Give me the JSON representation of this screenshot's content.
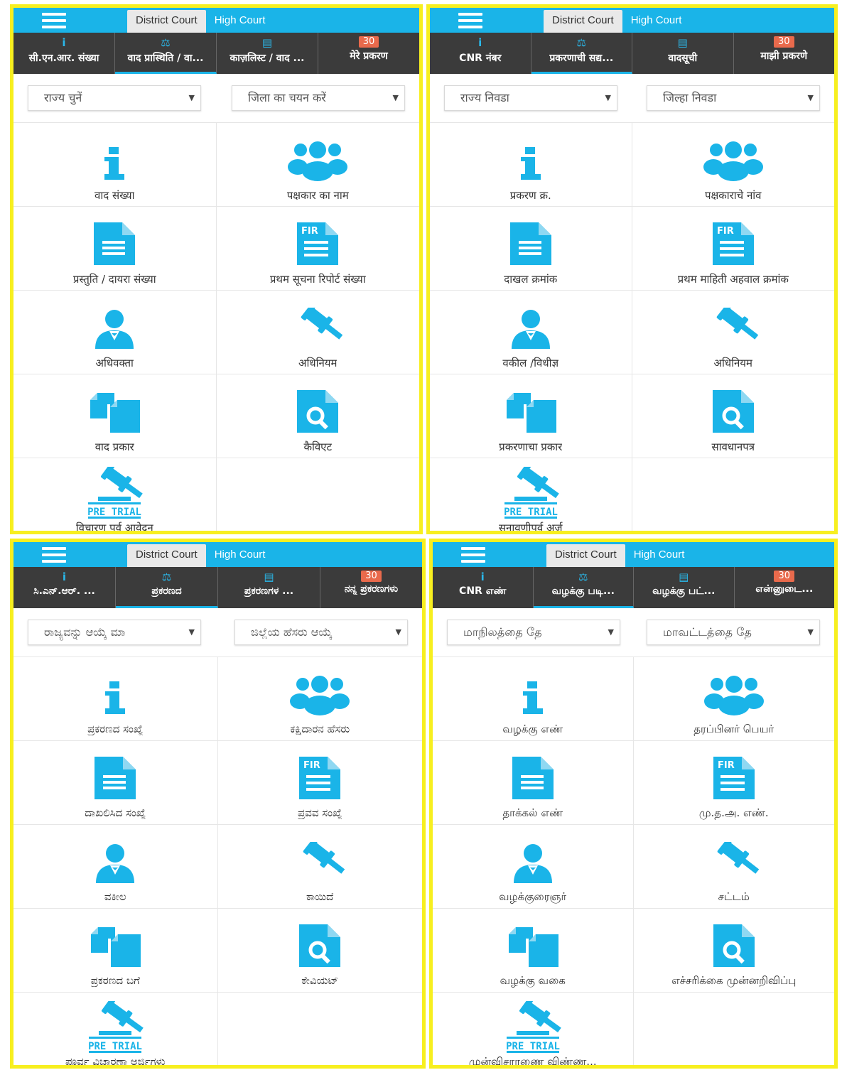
{
  "colors": {
    "accent": "#1ab4e8",
    "navbar": "#3b3b3b",
    "badge": "#e96a4c",
    "frame": "#f7ef1f"
  },
  "panels": [
    {
      "court_tabs": {
        "district": "District Court",
        "high": "High Court"
      },
      "nav_tabs": [
        {
          "icon": "info-icon",
          "label": "सी.एन.आर. संख्या"
        },
        {
          "icon": "scales-icon",
          "label": "वाद प्रास्थिति / वा...",
          "active": true
        },
        {
          "icon": "document-icon",
          "label": "काज़लिस्ट / वाद ..."
        },
        {
          "badge": "30",
          "label": "मेरे प्रकरण"
        }
      ],
      "state_select": "राज्य चुनें",
      "district_select": "जिला का चयन करें",
      "items": [
        {
          "icon": "info-icon",
          "label": "वाद संख्या"
        },
        {
          "icon": "people-icon",
          "label": "पक्षकार का नाम"
        },
        {
          "icon": "document-icon",
          "label": "प्रस्तुति / दायरा संख्या"
        },
        {
          "icon": "fir-document-icon",
          "label": "प्रथम सूचना रिपोर्ट संख्या"
        },
        {
          "icon": "advocate-icon",
          "label": "अधिवक्ता"
        },
        {
          "icon": "gavel-icon",
          "label": "अधिनियम"
        },
        {
          "icon": "case-type-icon",
          "label": "वाद प्रकार"
        },
        {
          "icon": "caveat-search-icon",
          "label": "कैविएट"
        },
        {
          "icon": "pre-trial-icon",
          "label": "विचारण पूर्व आवेदन"
        }
      ]
    },
    {
      "court_tabs": {
        "district": "District Court",
        "high": "High Court"
      },
      "nav_tabs": [
        {
          "icon": "info-icon",
          "label": "CNR नंबर"
        },
        {
          "icon": "scales-icon",
          "label": "प्रकरणाची सद्य...",
          "active": true
        },
        {
          "icon": "document-icon",
          "label": "वादसूची"
        },
        {
          "badge": "30",
          "label": "माझी प्रकरणे"
        }
      ],
      "state_select": "राज्य निवडा",
      "district_select": "जिल्हा निवडा",
      "items": [
        {
          "icon": "info-icon",
          "label": "प्रकरण क्र."
        },
        {
          "icon": "people-icon",
          "label": "पक्षकाराचे नांव"
        },
        {
          "icon": "document-icon",
          "label": "दाखल क्रमांक"
        },
        {
          "icon": "fir-document-icon",
          "label": "प्रथम माहिती अहवाल क्रमांक"
        },
        {
          "icon": "advocate-icon",
          "label": "वकील /विधीज्ञ"
        },
        {
          "icon": "gavel-icon",
          "label": "अधिनियम"
        },
        {
          "icon": "case-type-icon",
          "label": "प्रकरणाचा प्रकार"
        },
        {
          "icon": "caveat-search-icon",
          "label": "सावधानपत्र"
        },
        {
          "icon": "pre-trial-icon",
          "label": "सुनावणीपुर्व अर्ज"
        }
      ]
    },
    {
      "court_tabs": {
        "district": "District Court",
        "high": "High Court"
      },
      "nav_tabs": [
        {
          "icon": "info-icon",
          "label": "ಸಿ.ಎನ್.ಆರ್. ..."
        },
        {
          "icon": "scales-icon",
          "label": "ಪ್ರಕರಣದ",
          "active": true
        },
        {
          "icon": "document-icon",
          "label": "ಪ್ರಕರಣಗಳ ..."
        },
        {
          "badge": "30",
          "label": "ನನ್ನ ಪ್ರಕರಣಗಳು"
        }
      ],
      "state_select": "ರಾಜ್ಯವನ್ನು ಆಯ್ಕೆ ಮಾ",
      "district_select": "ಜಿಲ್ಲೆಯ ಹೆಸರು ಆಯ್ಕೆ",
      "items": [
        {
          "icon": "info-icon",
          "label": "ಪ್ರಕರಣದ ಸಂಖ್ಯೆ"
        },
        {
          "icon": "people-icon",
          "label": "ಕಕ್ಷಿದಾರನ ಹೆಸರು"
        },
        {
          "icon": "document-icon",
          "label": "ದಾಖಲಿಸಿದ ಸಂಖ್ಯೆ"
        },
        {
          "icon": "fir-document-icon",
          "label": "ಪ್ರವವ ಸಂಖ್ಯೆ"
        },
        {
          "icon": "advocate-icon",
          "label": "ವಕೀಲ"
        },
        {
          "icon": "gavel-icon",
          "label": "ಕಾಯಿದೆ"
        },
        {
          "icon": "case-type-icon",
          "label": "ಪ್ರಕರಣದ ಬಗೆ"
        },
        {
          "icon": "caveat-search-icon",
          "label": "ಕೇವಿಯಟ್"
        },
        {
          "icon": "pre-trial-icon",
          "label": "ಪೂರ್ವ ವಿಚಾರಣಾ ಅರ್ಜಿಗಳು"
        }
      ]
    },
    {
      "court_tabs": {
        "district": "District Court",
        "high": "High Court"
      },
      "nav_tabs": [
        {
          "icon": "info-icon",
          "label": "CNR எண்"
        },
        {
          "icon": "scales-icon",
          "label": "வழக்கு படி...",
          "active": true
        },
        {
          "icon": "document-icon",
          "label": "வழக்கு பட்..."
        },
        {
          "badge": "30",
          "label": "என்னுடை..."
        }
      ],
      "state_select": "மாநிலத்தை தே",
      "district_select": "மாவட்டத்தை தே",
      "items": [
        {
          "icon": "info-icon",
          "label": "வழக்கு எண்"
        },
        {
          "icon": "people-icon",
          "label": "தரப்பினர் பெயர்"
        },
        {
          "icon": "document-icon",
          "label": "தாக்கல் எண்"
        },
        {
          "icon": "fir-document-icon",
          "label": "மு.த.அ. எண்."
        },
        {
          "icon": "advocate-icon",
          "label": "வழக்குரைஞர்"
        },
        {
          "icon": "gavel-icon",
          "label": "சட்டம்"
        },
        {
          "icon": "case-type-icon",
          "label": "வழக்கு வகை"
        },
        {
          "icon": "caveat-search-icon",
          "label": "எச்சரிக்கை முன்னறிவிப்பு"
        },
        {
          "icon": "pre-trial-icon",
          "label": "முன்விசாரணை விண்ண..."
        }
      ]
    }
  ],
  "icon_text": {
    "fir": "FIR",
    "pre_trial": "PRE TRIAL"
  }
}
